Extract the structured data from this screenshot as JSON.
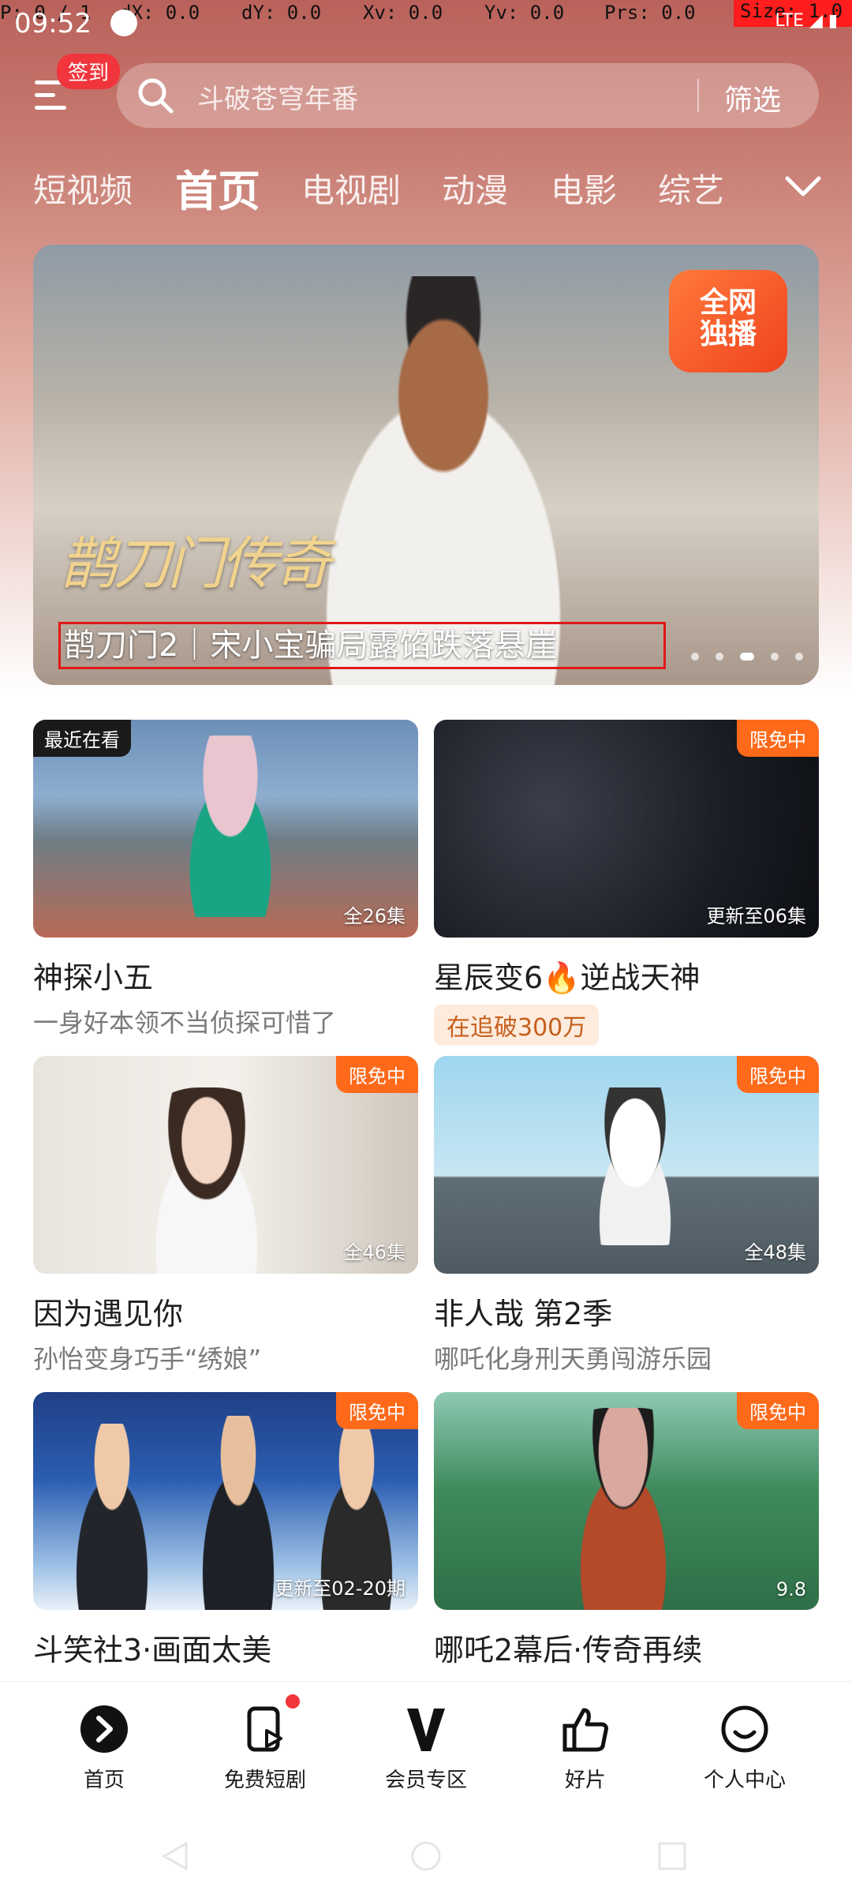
{
  "debug": {
    "p": "P: 0 / 1",
    "dx": "dX: 0.0",
    "dy": "dY: 0.0",
    "xv": "Xv: 0.0",
    "yv": "Yv: 0.0",
    "prs": "Prs: 0.0",
    "size": "Size: 1.0"
  },
  "status": {
    "time": "09:52",
    "network": "LTE"
  },
  "header": {
    "signin_badge": "签到",
    "search_placeholder": "斗破苍穹年番",
    "filter_label": "筛选"
  },
  "tabs": [
    "短视频",
    "首页",
    "电视剧",
    "动漫",
    "电影",
    "综艺"
  ],
  "banner": {
    "badge_line1": "全网",
    "badge_line2": "独播",
    "show_logo": "鹊刀门传奇",
    "caption": "鹊刀门2｜宋小宝骗局露馅跌落悬崖",
    "dots": 5,
    "active_dot": 2
  },
  "cards": [
    {
      "title": "神探小五",
      "subtitle": "一身好本领不当侦探可惜了",
      "tag_left": "最近在看",
      "tag_right": "",
      "episodes": "全26集"
    },
    {
      "title": "星辰变6🔥逆战天神",
      "subtitle": "",
      "pill": "在追破300万",
      "tag_left": "",
      "tag_right": "限免中",
      "episodes": "更新至06集"
    },
    {
      "title": "因为遇见你",
      "subtitle": "孙怡变身巧手“绣娘”",
      "tag_left": "",
      "tag_right": "限免中",
      "episodes": "全46集"
    },
    {
      "title": "非人哉 第2季",
      "subtitle": "哪吒化身刑天勇闯游乐园",
      "tag_left": "",
      "tag_right": "限免中",
      "episodes": "全48集"
    },
    {
      "title": "斗笑社3·画面太美",
      "subtitle": "",
      "tag_left": "",
      "tag_right": "限免中",
      "episodes": "更新至02-20期"
    },
    {
      "title": "哪吒2幕后·传奇再续",
      "subtitle": "",
      "tag_left": "",
      "tag_right": "限免中",
      "episodes": "9.8"
    }
  ],
  "bottom_nav": [
    {
      "label": "首页",
      "icon": "play-icon"
    },
    {
      "label": "免费短剧",
      "icon": "phone-play-icon"
    },
    {
      "label": "会员专区",
      "icon": "vip-v-icon"
    },
    {
      "label": "好片",
      "icon": "thumbs-up-icon"
    },
    {
      "label": "个人中心",
      "icon": "smile-icon"
    }
  ],
  "colors": {
    "accent": "#ff6a1a",
    "badge_red": "#f0353d",
    "header_bg": "#c77a70"
  }
}
